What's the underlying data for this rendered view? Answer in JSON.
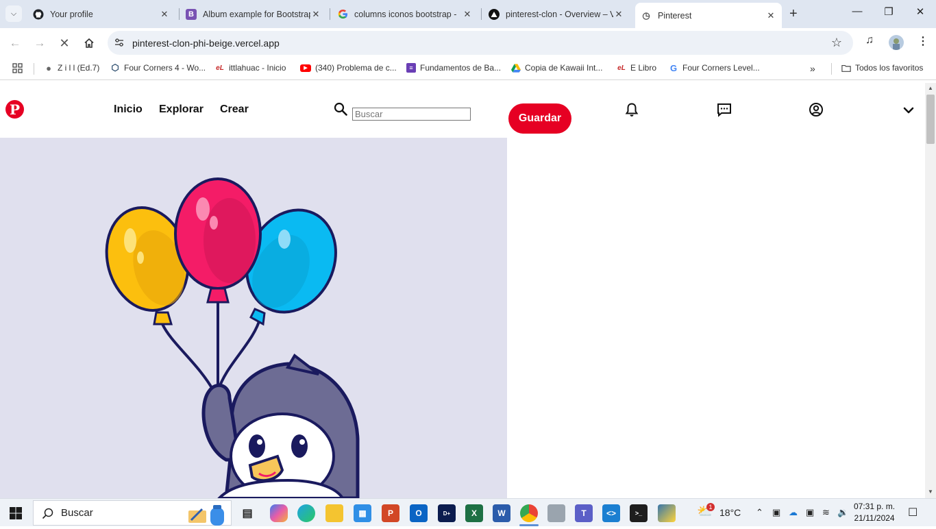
{
  "browser": {
    "tabs": [
      {
        "title": "Your profile",
        "favicon": "github-icon"
      },
      {
        "title": "Album example for Bootstrap",
        "favicon": "bootstrap-icon"
      },
      {
        "title": "columns iconos bootstrap -",
        "favicon": "google-icon"
      },
      {
        "title": "pinterest-clon - Overview – V",
        "favicon": "vercel-icon"
      },
      {
        "title": "Pinterest",
        "favicon": "loading-icon"
      }
    ],
    "url": "pinterest-clon-phi-beige.vercel.app",
    "bookmarks": [
      "Z i l l (Ed.7)",
      "Four Corners 4 - Wo...",
      "ittlahuac - Inicio",
      "(340) Problema de c...",
      "Fundamentos de Ba...",
      "Copia de Kawaii Int...",
      "E Libro",
      "Four Corners Level..."
    ],
    "all_bookmarks": "Todos los favoritos"
  },
  "site": {
    "logo": "P",
    "nav": [
      "Inicio",
      "Explorar",
      "Crear"
    ],
    "search_placeholder": "Buscar",
    "save_button": "Guardar"
  },
  "taskbar": {
    "search_text": "Buscar",
    "weather": "18°C",
    "weather_badge": "1",
    "time": "07:31 p. m.",
    "date": "21/11/2024"
  },
  "colors": {
    "pinterest_red": "#e60023",
    "hero_bg": "#e0e0ee"
  }
}
